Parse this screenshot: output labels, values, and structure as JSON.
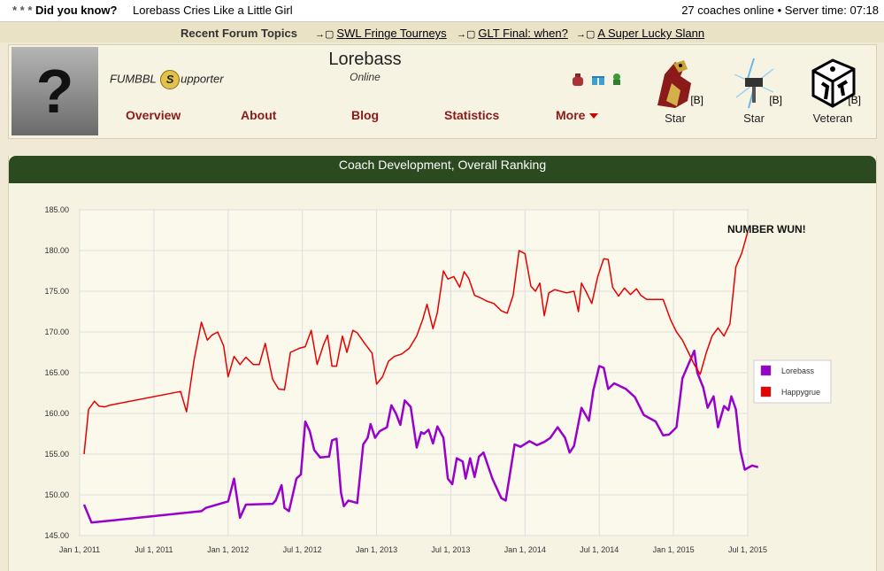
{
  "topbar": {
    "did_you_know_stars": "* * *",
    "did_you_know": "Did you know?",
    "fact": "Lorebass Cries Like a Little Girl",
    "status": "27 coaches online • Server time: 07:18"
  },
  "forum": {
    "title": "Recent Forum Topics",
    "topics": [
      "SWL Fringe Tourneys",
      "GLT Final: when?",
      "A Super Lucky Slann"
    ]
  },
  "coach": {
    "name": "Lorebass",
    "status": "Online",
    "supporter_prefix": "FUMBBL",
    "supporter_coin": "S",
    "supporter_suffix": "upporter",
    "avatar_glyph": "?"
  },
  "nav": {
    "overview": "Overview",
    "about": "About",
    "blog": "Blog",
    "statistics": "Statistics",
    "more": "More"
  },
  "trophies": [
    {
      "label": "Star",
      "badge": "[B]",
      "icon": "griffon-icon"
    },
    {
      "label": "Star",
      "badge": "[B]",
      "icon": "lightning-hammer-icon"
    },
    {
      "label": "Veteran",
      "badge": "[B]",
      "icon": "die-icon"
    }
  ],
  "chart": {
    "header": "Coach Development, Overall Ranking",
    "annotation": "NUMBER WUN!"
  },
  "chart_data": {
    "type": "line",
    "title": "Coach Development, Overall Ranking",
    "xlabel": "",
    "ylabel": "",
    "ylim": [
      145,
      185
    ],
    "yticks": [
      "145.00",
      "150.00",
      "155.00",
      "160.00",
      "165.00",
      "170.00",
      "175.00",
      "180.00",
      "185.00"
    ],
    "xticks": [
      "Jan 1, 2011",
      "Jul 1, 2011",
      "Jan 1, 2012",
      "Jul 1, 2012",
      "Jan 1, 2013",
      "Jul 1, 2013",
      "Jan 1, 2014",
      "Jul 1, 2014",
      "Jan 1, 2015",
      "Jul 1, 2015"
    ],
    "xlim_years": [
      2011.0,
      2015.5
    ],
    "legend_placement": "right",
    "grid": true,
    "series": [
      {
        "name": "Lorebass",
        "color": "#9900cc",
        "points": [
          [
            2011.03,
            148.8
          ],
          [
            2011.08,
            146.6
          ],
          [
            2011.82,
            148.0
          ],
          [
            2011.85,
            148.4
          ],
          [
            2012.0,
            149.2
          ],
          [
            2012.04,
            152.0
          ],
          [
            2012.08,
            147.2
          ],
          [
            2012.12,
            148.8
          ],
          [
            2012.3,
            148.9
          ],
          [
            2012.32,
            149.3
          ],
          [
            2012.36,
            151.2
          ],
          [
            2012.38,
            148.4
          ],
          [
            2012.41,
            148.0
          ],
          [
            2012.46,
            152.0
          ],
          [
            2012.49,
            152.5
          ],
          [
            2012.52,
            159.0
          ],
          [
            2012.55,
            157.8
          ],
          [
            2012.58,
            155.5
          ],
          [
            2012.62,
            154.6
          ],
          [
            2012.68,
            154.7
          ],
          [
            2012.7,
            156.7
          ],
          [
            2012.73,
            156.9
          ],
          [
            2012.76,
            150.3
          ],
          [
            2012.78,
            148.6
          ],
          [
            2012.81,
            149.3
          ],
          [
            2012.87,
            149.0
          ],
          [
            2012.91,
            156.2
          ],
          [
            2012.94,
            157.0
          ],
          [
            2012.96,
            158.7
          ],
          [
            2012.99,
            157.0
          ],
          [
            2013.02,
            157.8
          ],
          [
            2013.07,
            158.3
          ],
          [
            2013.1,
            161.0
          ],
          [
            2013.13,
            160.0
          ],
          [
            2013.16,
            158.6
          ],
          [
            2013.19,
            161.6
          ],
          [
            2013.23,
            160.8
          ],
          [
            2013.27,
            155.8
          ],
          [
            2013.3,
            157.7
          ],
          [
            2013.32,
            157.5
          ],
          [
            2013.35,
            158.0
          ],
          [
            2013.38,
            156.3
          ],
          [
            2013.41,
            158.4
          ],
          [
            2013.45,
            157.0
          ],
          [
            2013.48,
            152.0
          ],
          [
            2013.51,
            151.3
          ],
          [
            2013.54,
            154.5
          ],
          [
            2013.58,
            154.1
          ],
          [
            2013.6,
            152.0
          ],
          [
            2013.63,
            154.5
          ],
          [
            2013.66,
            152.2
          ],
          [
            2013.69,
            154.7
          ],
          [
            2013.72,
            155.2
          ],
          [
            2013.78,
            152.0
          ],
          [
            2013.84,
            149.6
          ],
          [
            2013.87,
            149.3
          ],
          [
            2013.93,
            156.2
          ],
          [
            2013.97,
            155.9
          ],
          [
            2014.03,
            156.6
          ],
          [
            2014.08,
            156.1
          ],
          [
            2014.13,
            156.5
          ],
          [
            2014.17,
            157.0
          ],
          [
            2014.22,
            158.3
          ],
          [
            2014.27,
            157.0
          ],
          [
            2014.3,
            155.2
          ],
          [
            2014.33,
            156.0
          ],
          [
            2014.38,
            160.7
          ],
          [
            2014.43,
            159.1
          ],
          [
            2014.46,
            162.8
          ],
          [
            2014.5,
            165.8
          ],
          [
            2014.53,
            165.6
          ],
          [
            2014.56,
            163.0
          ],
          [
            2014.6,
            163.7
          ],
          [
            2014.68,
            163.0
          ],
          [
            2014.74,
            162.0
          ],
          [
            2014.8,
            159.8
          ],
          [
            2014.84,
            159.4
          ],
          [
            2014.88,
            159.0
          ],
          [
            2014.93,
            157.3
          ],
          [
            2014.97,
            157.4
          ],
          [
            2015.02,
            158.3
          ],
          [
            2015.06,
            164.3
          ],
          [
            2015.1,
            166.0
          ],
          [
            2015.14,
            167.7
          ],
          [
            2015.16,
            165.0
          ],
          [
            2015.2,
            163.2
          ],
          [
            2015.23,
            160.7
          ],
          [
            2015.27,
            162.1
          ],
          [
            2015.3,
            158.3
          ],
          [
            2015.34,
            160.9
          ],
          [
            2015.37,
            160.4
          ],
          [
            2015.39,
            162.1
          ],
          [
            2015.42,
            160.5
          ],
          [
            2015.45,
            155.5
          ],
          [
            2015.48,
            153.1
          ],
          [
            2015.53,
            153.6
          ],
          [
            2015.57,
            153.4
          ]
        ]
      },
      {
        "name": "Happygrue",
        "color": "#e60000",
        "points": [
          [
            2011.03,
            155.0
          ],
          [
            2011.06,
            160.5
          ],
          [
            2011.1,
            161.5
          ],
          [
            2011.13,
            160.9
          ],
          [
            2011.17,
            160.8
          ],
          [
            2011.2,
            161.0
          ],
          [
            2011.68,
            162.7
          ],
          [
            2011.72,
            160.2
          ],
          [
            2011.77,
            166.5
          ],
          [
            2011.82,
            171.2
          ],
          [
            2011.86,
            169.0
          ],
          [
            2011.89,
            169.6
          ],
          [
            2011.93,
            170.0
          ],
          [
            2011.97,
            168.3
          ],
          [
            2012.0,
            164.5
          ],
          [
            2012.04,
            167.0
          ],
          [
            2012.08,
            166.0
          ],
          [
            2012.12,
            166.9
          ],
          [
            2012.17,
            166.0
          ],
          [
            2012.21,
            166.0
          ],
          [
            2012.25,
            168.6
          ],
          [
            2012.3,
            164.2
          ],
          [
            2012.34,
            163.0
          ],
          [
            2012.38,
            162.9
          ],
          [
            2012.42,
            167.5
          ],
          [
            2012.48,
            168.0
          ],
          [
            2012.52,
            168.2
          ],
          [
            2012.56,
            170.2
          ],
          [
            2012.6,
            166.0
          ],
          [
            2012.64,
            168.3
          ],
          [
            2012.67,
            169.6
          ],
          [
            2012.7,
            165.8
          ],
          [
            2012.73,
            165.8
          ],
          [
            2012.77,
            169.5
          ],
          [
            2012.8,
            167.5
          ],
          [
            2012.84,
            170.2
          ],
          [
            2012.87,
            169.9
          ],
          [
            2012.92,
            168.6
          ],
          [
            2012.97,
            167.4
          ],
          [
            2013.0,
            163.6
          ],
          [
            2013.04,
            164.5
          ],
          [
            2013.08,
            166.4
          ],
          [
            2013.12,
            167.0
          ],
          [
            2013.17,
            167.3
          ],
          [
            2013.22,
            168.0
          ],
          [
            2013.27,
            169.5
          ],
          [
            2013.31,
            171.5
          ],
          [
            2013.34,
            173.4
          ],
          [
            2013.38,
            170.4
          ],
          [
            2013.41,
            172.4
          ],
          [
            2013.45,
            177.5
          ],
          [
            2013.48,
            176.5
          ],
          [
            2013.52,
            176.8
          ],
          [
            2013.56,
            175.5
          ],
          [
            2013.59,
            177.4
          ],
          [
            2013.62,
            176.6
          ],
          [
            2013.66,
            174.5
          ],
          [
            2013.7,
            174.2
          ],
          [
            2013.74,
            173.8
          ],
          [
            2013.79,
            173.5
          ],
          [
            2013.84,
            172.6
          ],
          [
            2013.88,
            172.3
          ],
          [
            2013.92,
            174.5
          ],
          [
            2013.96,
            180.0
          ],
          [
            2014.0,
            179.6
          ],
          [
            2014.04,
            175.6
          ],
          [
            2014.07,
            175.0
          ],
          [
            2014.1,
            176.0
          ],
          [
            2014.13,
            172.0
          ],
          [
            2014.16,
            174.8
          ],
          [
            2014.2,
            175.2
          ],
          [
            2014.24,
            175.0
          ],
          [
            2014.28,
            174.8
          ],
          [
            2014.33,
            175.0
          ],
          [
            2014.36,
            172.5
          ],
          [
            2014.38,
            176.0
          ],
          [
            2014.41,
            175.0
          ],
          [
            2014.45,
            173.5
          ],
          [
            2014.49,
            176.8
          ],
          [
            2014.53,
            179.0
          ],
          [
            2014.56,
            178.9
          ],
          [
            2014.59,
            175.5
          ],
          [
            2014.63,
            174.4
          ],
          [
            2014.67,
            175.4
          ],
          [
            2014.71,
            174.6
          ],
          [
            2014.75,
            175.3
          ],
          [
            2014.78,
            174.5
          ],
          [
            2014.82,
            174.0
          ],
          [
            2014.87,
            174.0
          ],
          [
            2014.93,
            174.0
          ],
          [
            2014.98,
            171.5
          ],
          [
            2015.02,
            170.0
          ],
          [
            2015.06,
            169.0
          ],
          [
            2015.1,
            167.5
          ],
          [
            2015.14,
            166.0
          ],
          [
            2015.18,
            164.8
          ],
          [
            2015.22,
            167.4
          ],
          [
            2015.26,
            169.5
          ],
          [
            2015.3,
            170.5
          ],
          [
            2015.34,
            169.5
          ],
          [
            2015.38,
            171.0
          ],
          [
            2015.42,
            178.0
          ],
          [
            2015.46,
            179.7
          ],
          [
            2015.5,
            182.3
          ]
        ]
      }
    ]
  }
}
